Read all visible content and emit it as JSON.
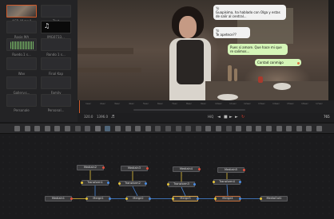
{
  "media_pool": {
    "clips": [
      {
        "caption": "ACR_W.mp4",
        "kind": "video",
        "selected": true
      },
      {
        "caption": "Text",
        "kind": "blank"
      },
      {
        "caption": "Rosie MA",
        "kind": "blank"
      },
      {
        "caption": "IMG0733...",
        "kind": "dark"
      },
      {
        "caption": "Ruedo.1 s...",
        "kind": "audio"
      },
      {
        "caption": "Rondo 1 s...",
        "kind": "blank"
      },
      {
        "caption": "Wav",
        "kind": "blank"
      },
      {
        "caption": "Final Kap",
        "kind": "blank"
      },
      {
        "caption": "Gallery.s...",
        "kind": "blank"
      },
      {
        "caption": "Family",
        "kind": "blank"
      },
      {
        "caption": "Personale",
        "kind": "blank"
      },
      {
        "caption": "Personal...",
        "kind": "blank"
      }
    ]
  },
  "viewer": {
    "bubbles": [
      {
        "who": "Yo",
        "text": "Guapísima, ha hablado con Olga y estas de salir al central...",
        "side": "in"
      },
      {
        "who": "Yo",
        "text": "Te apetece??",
        "side": "in"
      },
      {
        "who": "",
        "text": "Pues si amore. Que hace mi que re salimos...",
        "side": "out"
      },
      {
        "who": "",
        "text": "Contad conmigo",
        "side": "out"
      }
    ]
  },
  "ruler": {
    "ticks": [
      "1sec",
      "2sec",
      "3sec",
      "4sec",
      "5sec",
      "6sec",
      "7sec",
      "8sec",
      "9sec",
      "10sec",
      "11sec",
      "12sec",
      "13sec",
      "14sec",
      "15sec",
      "16sec",
      "17sec"
    ]
  },
  "transport": {
    "start_frame": "320.0",
    "end_frame": "1396.0",
    "hiq_label": "HiQ",
    "current_frame": "765"
  },
  "node_editor": {
    "nodes": {
      "m1": "MediaIn1",
      "m2": "MediaIn2",
      "m3": "MediaIn3",
      "m4": "MediaIn4",
      "m5": "MediaIn5",
      "t1": "Transform1",
      "t2": "Transform2",
      "t3": "Transform3",
      "t4": "Transform4",
      "mg1": "Merge1",
      "mg2": "Merge2",
      "mg3": "Merge3",
      "mg4": "Merge4",
      "out": "MediaOut1"
    }
  },
  "colors": {
    "accent": "#cf5a2a",
    "audio_wave": "#7ec46b",
    "record": "#d63a2b"
  }
}
